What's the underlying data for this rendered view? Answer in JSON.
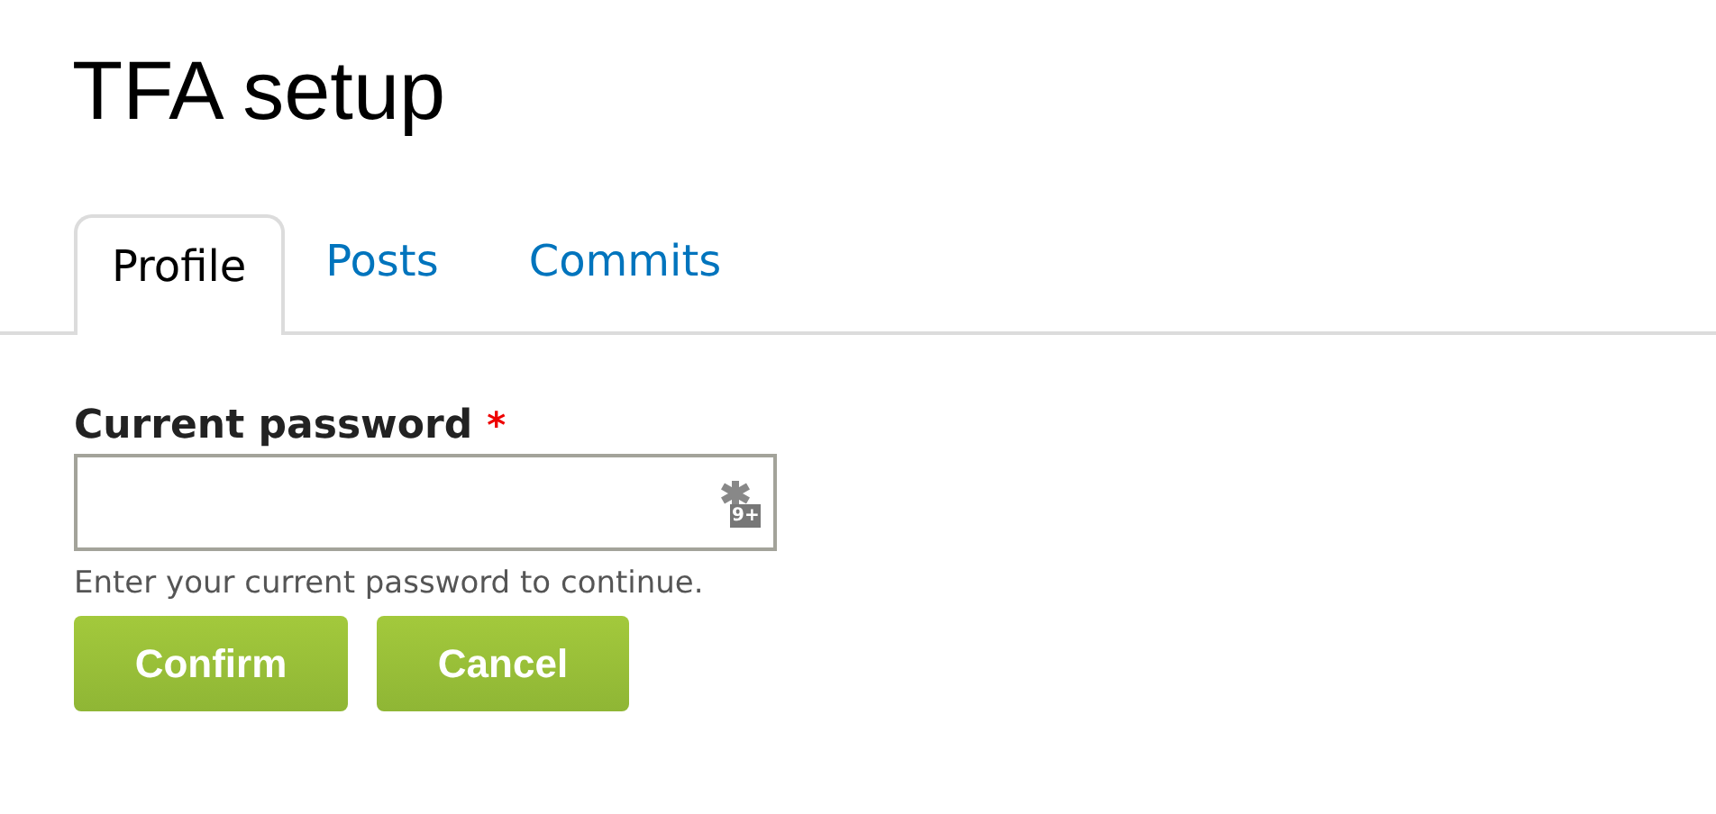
{
  "title": "TFA setup",
  "tabs": [
    {
      "label": "Profile",
      "selected": true
    },
    {
      "label": "Posts",
      "selected": false
    },
    {
      "label": "Commits",
      "selected": false
    }
  ],
  "field": {
    "label": "Current password",
    "required_mark": "*",
    "badge": "9+",
    "description": "Enter your current password to continue."
  },
  "buttons": [
    {
      "label": "Confirm"
    },
    {
      "label": "Cancel"
    }
  ]
}
